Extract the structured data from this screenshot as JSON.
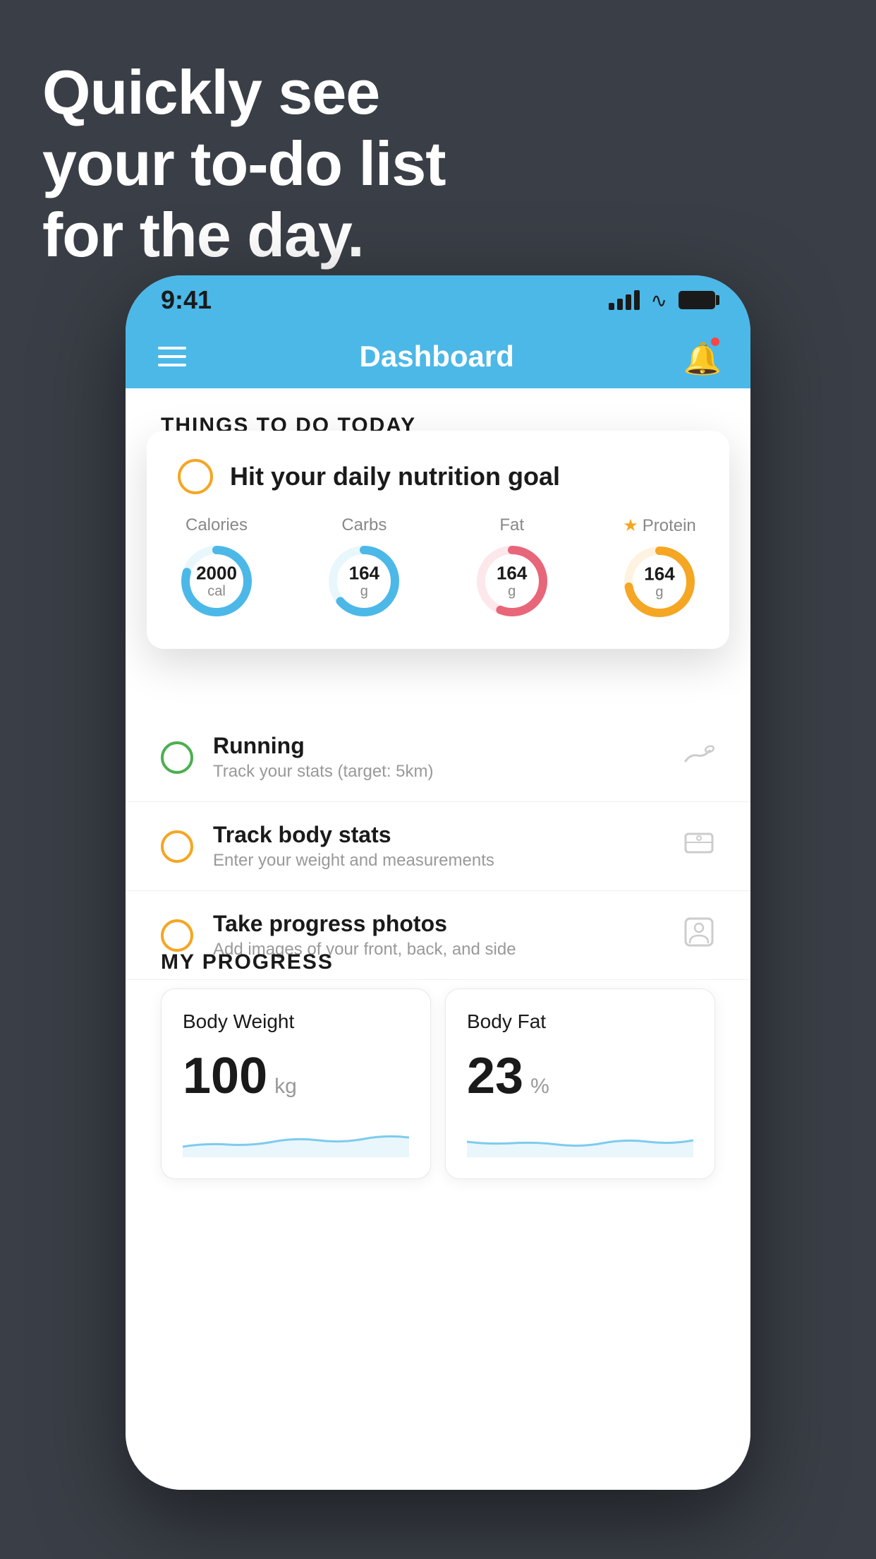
{
  "headline": {
    "line1": "Quickly see",
    "line2": "your to-do list",
    "line3": "for the day."
  },
  "status_bar": {
    "time": "9:41"
  },
  "nav": {
    "title": "Dashboard"
  },
  "things_header": "THINGS TO DO TODAY",
  "floating_card": {
    "title": "Hit your daily nutrition goal",
    "nutrition": [
      {
        "label": "Calories",
        "value": "2000",
        "unit": "cal",
        "color": "#4bb8e8",
        "star": false
      },
      {
        "label": "Carbs",
        "value": "164",
        "unit": "g",
        "color": "#4bb8e8",
        "star": false
      },
      {
        "label": "Fat",
        "value": "164",
        "unit": "g",
        "color": "#e8667a",
        "star": false
      },
      {
        "label": "Protein",
        "value": "164",
        "unit": "g",
        "color": "#f5a623",
        "star": true
      }
    ]
  },
  "todo_items": [
    {
      "title": "Running",
      "subtitle": "Track your stats (target: 5km)",
      "check_color": "green",
      "icon": "🏃"
    },
    {
      "title": "Track body stats",
      "subtitle": "Enter your weight and measurements",
      "check_color": "yellow",
      "icon": "⚖"
    },
    {
      "title": "Take progress photos",
      "subtitle": "Add images of your front, back, and side",
      "check_color": "yellow",
      "icon": "👤"
    }
  ],
  "progress_section": {
    "header": "MY PROGRESS",
    "cards": [
      {
        "title": "Body Weight",
        "value": "100",
        "unit": "kg"
      },
      {
        "title": "Body Fat",
        "value": "23",
        "unit": "%"
      }
    ]
  }
}
